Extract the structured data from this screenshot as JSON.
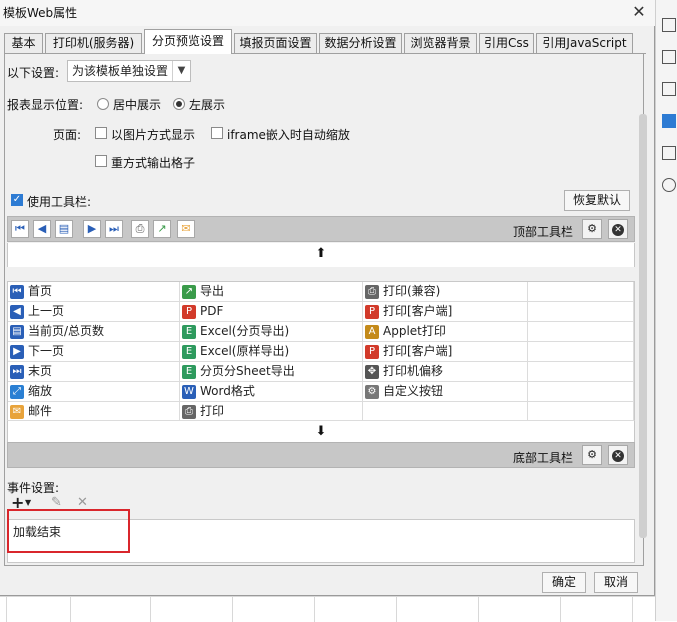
{
  "window": {
    "title": "模板Web属性",
    "close_glyph": "✕"
  },
  "tabs": [
    {
      "label": "基本"
    },
    {
      "label": "打印机(服务器)"
    },
    {
      "label": "分页预览设置"
    },
    {
      "label": "填报页面设置"
    },
    {
      "label": "数据分析设置"
    },
    {
      "label": "浏览器背景"
    },
    {
      "label": "引用Css"
    },
    {
      "label": "引用JavaScript"
    }
  ],
  "settings": {
    "scope_label": "以下设置:",
    "scope_value": "为该模板单独设置",
    "position_label": "报表显示位置:",
    "position_options": [
      {
        "label": "居中展示",
        "selected": false
      },
      {
        "label": "左展示",
        "selected": true
      }
    ],
    "page_label": "页面:",
    "page_options": [
      {
        "label": "以图片方式显示",
        "checked": false
      },
      {
        "label": "iframe嵌入时自动缩放",
        "checked": false
      },
      {
        "label": "重方式输出格子",
        "checked": false
      }
    ],
    "use_toolbar_label": "使用工具栏:",
    "use_toolbar_checked": true,
    "restore_default_label": "恢复默认"
  },
  "top_toolbar": {
    "title": "顶部工具栏",
    "settings_glyph": "⚙",
    "delete_glyph": "✕"
  },
  "bottom_toolbar": {
    "title": "底部工具栏",
    "settings_glyph": "⚙",
    "delete_glyph": "✕"
  },
  "move_up_glyph": "⬆",
  "move_down_glyph": "⬇",
  "toolbar_items": [
    [
      {
        "label": "首页",
        "icon": "first-page-icon",
        "glyph": "⏮",
        "color": "#2a5fb7"
      },
      {
        "label": "导出",
        "icon": "export-icon",
        "glyph": "↗",
        "color": "#3a9b4a"
      },
      {
        "label": "打印(兼容)",
        "icon": "printer-icon",
        "glyph": "⎙",
        "color": "#666666"
      }
    ],
    [
      {
        "label": "上一页",
        "icon": "prev-page-icon",
        "glyph": "◀",
        "color": "#2a5fb7"
      },
      {
        "label": "PDF",
        "icon": "pdf-icon",
        "glyph": "P",
        "color": "#d23a2a"
      },
      {
        "label": "打印[客户端]",
        "icon": "client-print-pdf-icon",
        "glyph": "P",
        "color": "#d23a2a"
      }
    ],
    [
      {
        "label": "当前页/总页数",
        "icon": "page-count-icon",
        "glyph": "▤",
        "color": "#2a5fb7"
      },
      {
        "label": "Excel(分页导出)",
        "icon": "excel-icon",
        "glyph": "E",
        "color": "#2e9a5e"
      },
      {
        "label": "Applet打印",
        "icon": "applet-print-icon",
        "glyph": "A",
        "color": "#c48a1a"
      }
    ],
    [
      {
        "label": "下一页",
        "icon": "next-page-icon",
        "glyph": "▶",
        "color": "#2a5fb7"
      },
      {
        "label": "Excel(原样导出)",
        "icon": "excel-icon",
        "glyph": "E",
        "color": "#2e9a5e"
      },
      {
        "label": "打印[客户端]",
        "icon": "client-print-icon",
        "glyph": "P",
        "color": "#d23a2a"
      }
    ],
    [
      {
        "label": "末页",
        "icon": "last-page-icon",
        "glyph": "⏭",
        "color": "#2a5fb7"
      },
      {
        "label": "分页分Sheet导出",
        "icon": "excel-icon",
        "glyph": "E",
        "color": "#2e9a5e"
      },
      {
        "label": "打印机偏移",
        "icon": "move-icon",
        "glyph": "✥",
        "color": "#555555"
      }
    ],
    [
      {
        "label": "缩放",
        "icon": "zoom-icon",
        "glyph": "⤢",
        "color": "#2a7fd3"
      },
      {
        "label": "Word格式",
        "icon": "word-icon",
        "glyph": "W",
        "color": "#2a5fb7"
      },
      {
        "label": "自定义按钮",
        "icon": "gear-icon",
        "glyph": "⚙",
        "color": "#777777"
      }
    ],
    [
      {
        "label": "邮件",
        "icon": "mail-icon",
        "glyph": "✉",
        "color": "#e8a33b"
      },
      {
        "label": "打印",
        "icon": "printer-icon",
        "glyph": "⎙",
        "color": "#666666"
      },
      {
        "label": "",
        "icon": "",
        "glyph": "",
        "color": "#ffffff"
      }
    ]
  ],
  "events": {
    "label": "事件设置:",
    "add_glyph": "+",
    "edit_glyph": "✎",
    "remove_glyph": "✕",
    "items": [
      {
        "label": "加载结束"
      }
    ]
  },
  "footer": {
    "ok_label": "确定",
    "cancel_label": "取消"
  },
  "colors": {
    "highlight": "#d9262c",
    "accent": "#2d7bd3"
  }
}
